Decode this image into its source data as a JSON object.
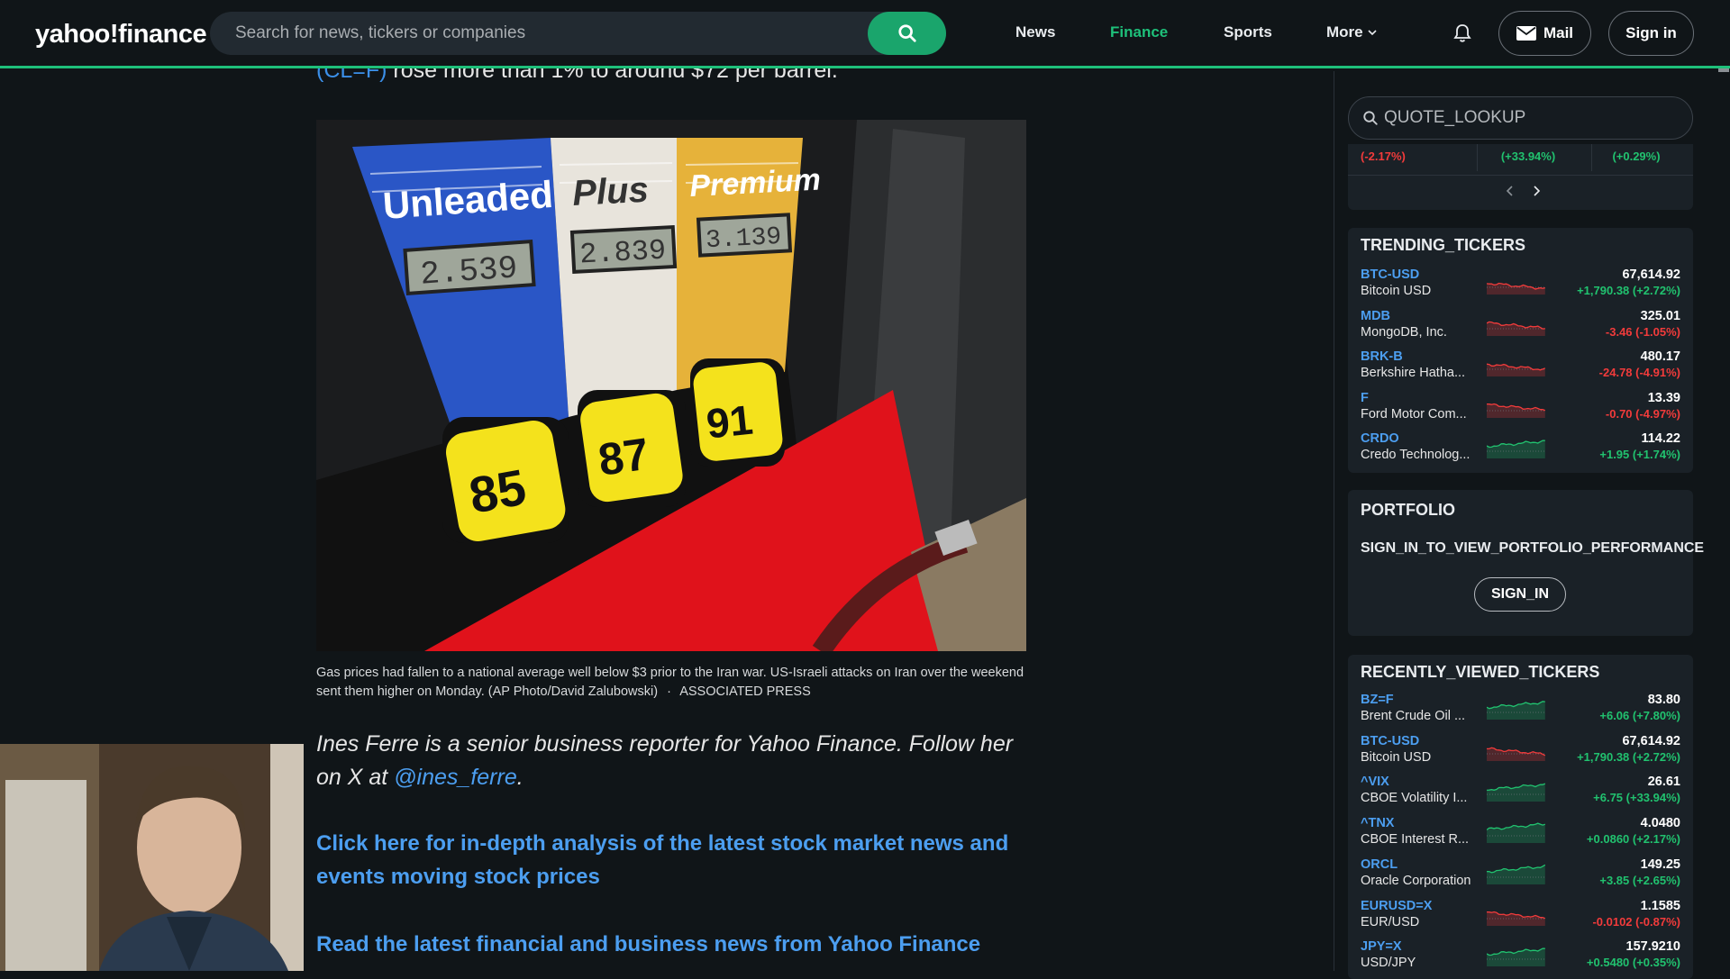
{
  "header": {
    "logo": "yahoo!finance",
    "search_placeholder": "Search for news, tickers or companies",
    "nav": [
      "News",
      "Finance",
      "Sports",
      "More"
    ],
    "active_nav": "Finance",
    "mail_label": "Mail",
    "signin_label": "Sign in"
  },
  "article": {
    "clipped_line_ticker": "(CL=F)",
    "clipped_line_text": " rose more than 1% to around $72 per barrel.",
    "photo_text": {
      "unleaded": "Unleaded",
      "plus": "Plus",
      "premium": "Premium",
      "price_unleaded": "2.539",
      "price_plus": "2.839",
      "price_premium": "3.139",
      "octane_low": "85",
      "octane_mid": "87",
      "octane_high": "91"
    },
    "caption": "Gas prices had fallen to a national average well below $3 prior to the Iran war. US-Israeli attacks on Iran over the weekend sent them higher on Monday. (AP Photo/David Zalubowski)",
    "caption_separator": "·",
    "caption_credit": "ASSOCIATED PRESS",
    "author_text": "Ines Ferre is a senior business reporter for Yahoo Finance. Follow her on X at ",
    "author_handle": "@ines_ferre",
    "author_end": ".",
    "cta_analysis": "Click here for in-depth analysis of the latest stock market news and events moving stock prices",
    "cta_news": "Read the latest financial and business news from Yahoo Finance"
  },
  "rail": {
    "quote_placeholder": "QUOTE_LOOKUP",
    "market_changes": [
      "(-2.17%)",
      "(+33.94%)",
      "(+0.29%)"
    ],
    "market_change_dirs": [
      "down",
      "up",
      "up"
    ],
    "trending_title": "TRENDING_TICKERS",
    "trending": [
      {
        "symbol": "BTC-USD",
        "name": "Bitcoin USD",
        "price": "67,614.92",
        "change": "+1,790.38 (+2.72%)",
        "dir": "down"
      },
      {
        "symbol": "MDB",
        "name": "MongoDB, Inc.",
        "price": "325.01",
        "change": "-3.46 (-1.05%)",
        "dir": "down"
      },
      {
        "symbol": "BRK-B",
        "name": "Berkshire Hatha...",
        "price": "480.17",
        "change": "-24.78 (-4.91%)",
        "dir": "down"
      },
      {
        "symbol": "F",
        "name": "Ford Motor Com...",
        "price": "13.39",
        "change": "-0.70 (-4.97%)",
        "dir": "down"
      },
      {
        "symbol": "CRDO",
        "name": "Credo Technolog...",
        "price": "114.22",
        "change": "+1.95 (+1.74%)",
        "dir": "up"
      }
    ],
    "portfolio_title": "PORTFOLIO",
    "portfolio_message": "SIGN_IN_TO_VIEW_PORTFOLIO_PERFORMANCE",
    "portfolio_signin": "SIGN_IN",
    "recent_title": "RECENTLY_VIEWED_TICKERS",
    "recent": [
      {
        "symbol": "BZ=F",
        "name": "Brent Crude Oil ...",
        "price": "83.80",
        "change": "+6.06 (+7.80%)",
        "dir": "up"
      },
      {
        "symbol": "BTC-USD",
        "name": "Bitcoin USD",
        "price": "67,614.92",
        "change": "+1,790.38 (+2.72%)",
        "dir": "down"
      },
      {
        "symbol": "^VIX",
        "name": "CBOE Volatility I...",
        "price": "26.61",
        "change": "+6.75 (+33.94%)",
        "dir": "up"
      },
      {
        "symbol": "^TNX",
        "name": "CBOE Interest R...",
        "price": "4.0480",
        "change": "+0.0860 (+2.17%)",
        "dir": "up"
      },
      {
        "symbol": "ORCL",
        "name": "Oracle Corporation",
        "price": "149.25",
        "change": "+3.85 (+2.65%)",
        "dir": "up"
      },
      {
        "symbol": "EURUSD=X",
        "name": "EUR/USD",
        "price": "1.1585",
        "change": "-0.0102 (-0.87%)",
        "dir": "down"
      },
      {
        "symbol": "JPY=X",
        "name": "USD/JPY",
        "price": "157.9210",
        "change": "+0.5480 (+0.35%)",
        "dir": "up"
      }
    ]
  },
  "colors": {
    "accent_green": "#1ec07a",
    "link_blue": "#4c9ef0",
    "up": "#21c26f",
    "down": "#f23b3b",
    "background": "#101518",
    "card": "#1a2127"
  }
}
